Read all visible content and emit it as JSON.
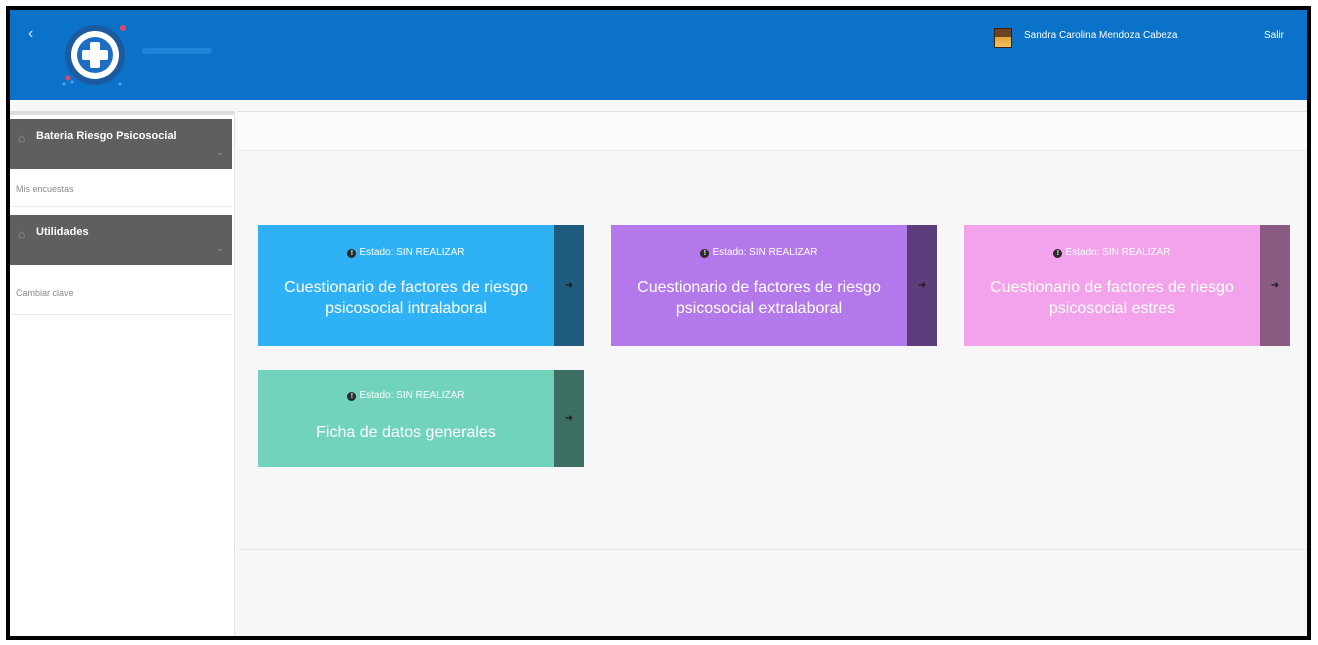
{
  "header": {
    "back_icon": "chevron-left-icon",
    "logo_icon": "medical-cross-icon",
    "user_name": "Sandra Carolina Mendoza Cabeza",
    "logout_label": "Salir"
  },
  "sidebar": {
    "sections": [
      {
        "title": "Bateria Riesgo Psicosocial",
        "icon": "home-icon",
        "item": "Mis encuestas"
      },
      {
        "title": "Utilidades",
        "icon": "home-icon",
        "item": "Cambiar clave"
      }
    ]
  },
  "cards": [
    {
      "status": "Estado: SIN REALIZAR",
      "title": "Cuestionario de factores de riesgo psicosocial intralaboral",
      "color": "#2fb2f5",
      "accent": "#205c7d"
    },
    {
      "status": "Estado: SIN REALIZAR",
      "title": "Cuestionario de factores de riesgo psicosocial extralaboral",
      "color": "#b378ea",
      "accent": "#5e3d7c"
    },
    {
      "status": "Estado: SIN REALIZAR",
      "title": "Cuestionario de factores de riesgo psicosocial estres",
      "color": "#f3a3ec",
      "accent": "#8a5b82"
    },
    {
      "status": "Estado: SIN REALIZAR",
      "title": "Ficha de datos generales",
      "color": "#71d3bb",
      "accent": "#3d6e63"
    }
  ],
  "glyphs": {
    "arrow": "➜",
    "info": "!",
    "home": "⌂",
    "chevron_down": "⌄",
    "back": "‹"
  }
}
